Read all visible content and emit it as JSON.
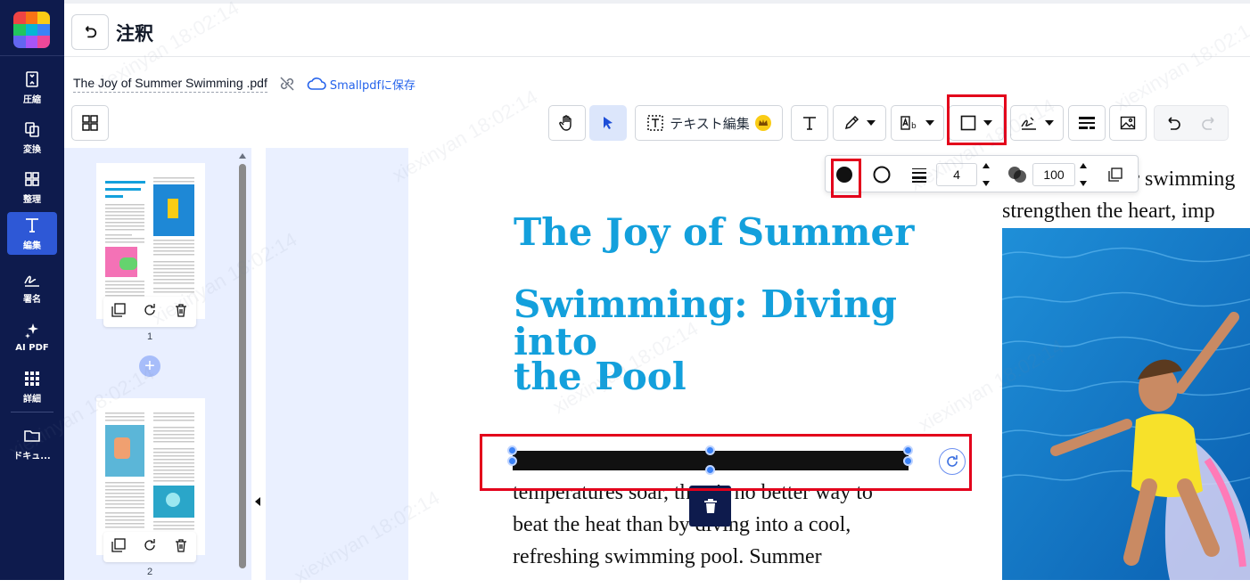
{
  "sidebar": {
    "items": [
      {
        "label": "圧縮",
        "icon": "compress-icon"
      },
      {
        "label": "変換",
        "icon": "convert-icon"
      },
      {
        "label": "整理",
        "icon": "organize-icon"
      },
      {
        "label": "編集",
        "icon": "edit-icon"
      },
      {
        "label": "署名",
        "icon": "sign-icon"
      },
      {
        "label": "AI PDF",
        "icon": "sparkle-icon"
      },
      {
        "label": "詳細",
        "icon": "grid-dots-icon"
      },
      {
        "label": "ドキュ...",
        "icon": "folder-icon"
      }
    ],
    "active": "編集"
  },
  "header": {
    "title": "注釈"
  },
  "file": {
    "name": "The Joy of Summer Swimming .pdf",
    "save_label": "Smallpdfに保存"
  },
  "toolbar": {
    "text_edit_label": "テキスト編集",
    "tools": [
      "hand-tool",
      "select-tool",
      "text-edit",
      "text-tool",
      "pen-tool",
      "highlight-text-tool",
      "shape-tool",
      "signature-tool",
      "strikeout-tool",
      "image-tool",
      "undo",
      "redo"
    ]
  },
  "shape_options": {
    "fill": "filled",
    "stroke_width": "4",
    "opacity": "100"
  },
  "thumbnails": [
    {
      "page": "1"
    },
    {
      "page": "2"
    }
  ],
  "document": {
    "title_lines": [
      "The Joy of Summer",
      "Swimming: Diving into",
      "the Pool"
    ],
    "right_text": [
      "r swimming",
      "strengthen the heart, imp"
    ],
    "body_lines": [
      "temperatures soar, there's no better way to",
      "beat the heat than by diving into a cool,",
      "refreshing swimming pool. Summer"
    ]
  },
  "colors": {
    "accent": "#2e58d6",
    "sidebar_bg": "#0e1b4d",
    "title_blue": "#13a0dc",
    "highlight_red": "#e3001b"
  },
  "watermark": "xiexinyan 18:02:14"
}
